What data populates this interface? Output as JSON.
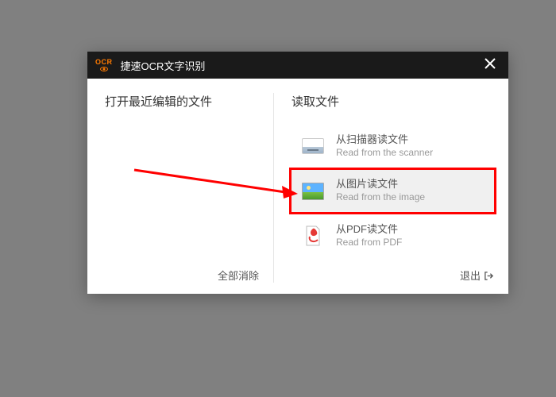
{
  "titlebar": {
    "logo_text": "OCR",
    "title": "捷速OCR文字识别"
  },
  "left": {
    "heading": "打开最近编辑的文件",
    "clear_all": "全部消除"
  },
  "right": {
    "heading": "读取文件",
    "options": [
      {
        "zh": "从扫描器读文件",
        "en": "Read from the scanner"
      },
      {
        "zh": "从图片读文件",
        "en": "Read from the image"
      },
      {
        "zh": "从PDF读文件",
        "en": "Read from PDF"
      }
    ],
    "exit": "退出"
  }
}
